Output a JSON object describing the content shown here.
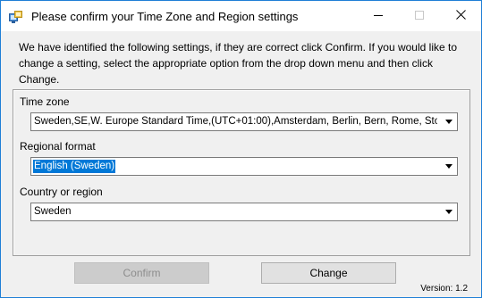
{
  "window": {
    "title": "Please confirm your Time Zone and Region settings",
    "accent_border": "#1f7fd6"
  },
  "caption_buttons": {
    "minimize_icon": "minimize-icon",
    "maximize_icon": "maximize-icon",
    "close_icon": "close-icon"
  },
  "intro_text": "We have identified the following settings, if they are correct click Confirm. If you would like to change a setting, select the appropriate option from the drop down menu and then click Change.",
  "fields": {
    "time_zone": {
      "label": "Time zone",
      "value": "Sweden,SE,W. Europe Standard Time,(UTC+01:00),Amsterdam, Berlin, Bern, Rome, Stockholm, Vienna"
    },
    "regional_format": {
      "label": "Regional format",
      "value": "English (Sweden)",
      "selected_highlight": "#0078d7"
    },
    "country_region": {
      "label": "Country or region",
      "value": "Sweden"
    }
  },
  "buttons": {
    "confirm_label": "Confirm",
    "confirm_enabled": false,
    "change_label": "Change"
  },
  "version_text": "Version: 1.2"
}
